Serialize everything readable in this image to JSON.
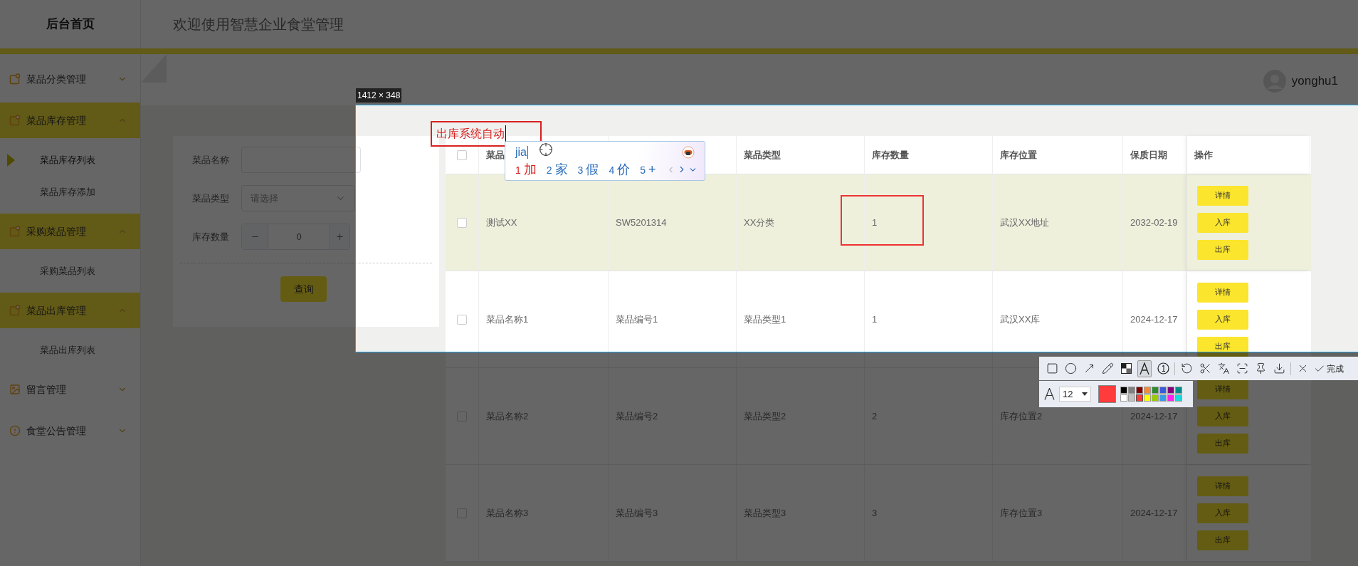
{
  "header": {
    "brand": "后台首页",
    "title": "欢迎使用智慧企业食堂管理"
  },
  "sidebar": {
    "items": [
      {
        "label": "菜品分类管理",
        "kind": "note",
        "expanded": false
      },
      {
        "label": "菜品库存管理",
        "kind": "note",
        "expanded": true,
        "children": [
          {
            "label": "菜品库存列表",
            "selected": true
          },
          {
            "label": "菜品库存添加",
            "selected": false
          }
        ]
      },
      {
        "label": "采购菜品管理",
        "kind": "note",
        "expanded": true,
        "children": [
          {
            "label": "采购菜品列表",
            "selected": false
          }
        ]
      },
      {
        "label": "菜品出库管理",
        "kind": "note",
        "expanded": true,
        "children": [
          {
            "label": "菜品出库列表",
            "selected": false
          }
        ]
      },
      {
        "label": "留言管理",
        "kind": "image",
        "expanded": false
      },
      {
        "label": "食堂公告管理",
        "kind": "info",
        "expanded": false
      }
    ]
  },
  "user": {
    "name": "yonghu1"
  },
  "search": {
    "fields": [
      {
        "kind": "text",
        "label": "菜品名称"
      },
      {
        "kind": "select",
        "label": "菜品类型",
        "placeholder": "请选择"
      },
      {
        "kind": "number",
        "label": "库存数量",
        "value": "0"
      }
    ],
    "button": "查询"
  },
  "table": {
    "select_all_checked": false,
    "columns": [
      "菜品",
      "",
      "菜品类型",
      "库存数量",
      "库存位置",
      "保质日期",
      "操作"
    ],
    "rows": [
      {
        "highlighted": true,
        "checked": false,
        "cells": [
          "测试XX",
          "SW5201314",
          "XX分类",
          "1",
          "武汉XX地址",
          "2032-02-19"
        ],
        "actions": [
          "详情",
          "入库",
          "出库"
        ]
      },
      {
        "highlighted": false,
        "checked": false,
        "cells": [
          "菜品名称1",
          "菜品编号1",
          "菜品类型1",
          "1",
          "武汉XX库",
          "2024-12-17"
        ],
        "actions": [
          "详情",
          "入库",
          "出库"
        ]
      },
      {
        "highlighted": false,
        "checked": false,
        "cells": [
          "菜品名称2",
          "菜品编号2",
          "菜品类型2",
          "2",
          "库存位置2",
          "2024-12-17"
        ],
        "actions": [
          "详情",
          "入库",
          "出库"
        ]
      },
      {
        "highlighted": false,
        "checked": false,
        "cells": [
          "菜品名称3",
          "菜品编号3",
          "菜品类型3",
          "3",
          "库存位置3",
          "2024-12-17"
        ],
        "actions": [
          "详情",
          "入库",
          "出库"
        ]
      }
    ]
  },
  "screenshot_tool": {
    "size_label": "1412 × 348",
    "annotation_text": "出库系统自动",
    "ime": {
      "input": "jia",
      "candidates": [
        {
          "index": "1",
          "text": "加",
          "selected": true
        },
        {
          "index": "2",
          "text": "家",
          "selected": false
        },
        {
          "index": "3",
          "text": "假",
          "selected": false
        },
        {
          "index": "4",
          "text": "价",
          "selected": false
        },
        {
          "index": "5",
          "text": "+",
          "selected": false
        }
      ]
    },
    "tools": [
      {
        "kind": "rect",
        "selected": false
      },
      {
        "kind": "ellipse",
        "selected": false
      },
      {
        "kind": "arrow",
        "selected": false
      },
      {
        "kind": "pen",
        "selected": false
      },
      {
        "kind": "mosaic",
        "selected": false
      },
      {
        "kind": "text",
        "selected": true
      },
      {
        "kind": "number",
        "selected": false
      },
      {
        "kind": "divider"
      },
      {
        "kind": "undo",
        "selected": false
      },
      {
        "kind": "cut",
        "selected": false
      },
      {
        "kind": "translate",
        "selected": false
      },
      {
        "kind": "scan",
        "selected": false
      },
      {
        "kind": "pin",
        "selected": false
      },
      {
        "kind": "download",
        "selected": false
      },
      {
        "kind": "divider"
      },
      {
        "kind": "close",
        "selected": false
      }
    ],
    "done": "完成",
    "font_size": "12",
    "palette": [
      {
        "color": "#000000",
        "selected": false
      },
      {
        "color": "#808080",
        "selected": false
      },
      {
        "color": "#800000",
        "selected": false
      },
      {
        "color": "#f28c38",
        "selected": false
      },
      {
        "color": "#2e8b2e",
        "selected": false
      },
      {
        "color": "#3a5bd8",
        "selected": false
      },
      {
        "color": "#800080",
        "selected": false
      },
      {
        "color": "#008b8b",
        "selected": false
      },
      {
        "color": "#ffffff",
        "selected": false
      },
      {
        "color": "#c0c0c0",
        "selected": false
      },
      {
        "color": "#ff3b3b",
        "selected": true
      },
      {
        "color": "#ffff00",
        "selected": false
      },
      {
        "color": "#99cc00",
        "selected": false
      },
      {
        "color": "#3a9ae6",
        "selected": false
      },
      {
        "color": "#ff22ee",
        "selected": false
      },
      {
        "color": "#1ad9e0",
        "selected": false
      }
    ]
  }
}
